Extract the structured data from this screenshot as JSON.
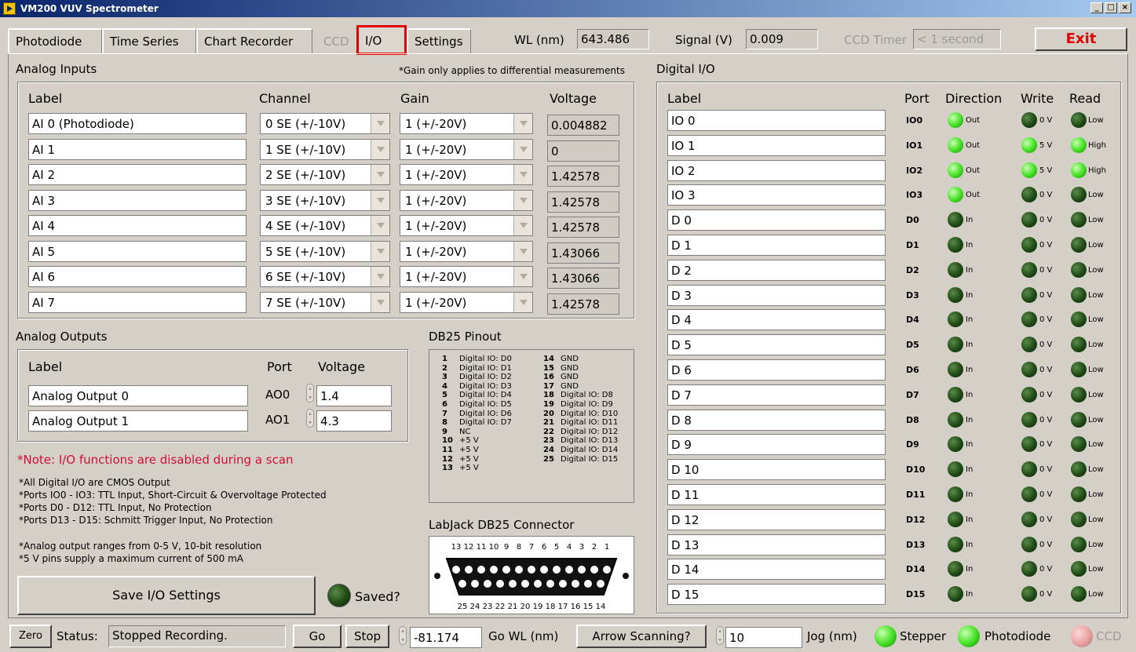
{
  "window": {
    "title": "VM200 VUV Spectrometer",
    "minimize": "_",
    "maximize": "□",
    "close": "×"
  },
  "tabs": [
    "Photodiode",
    "Time Series",
    "Chart Recorder",
    "CCD",
    "I/O",
    "Settings"
  ],
  "header": {
    "wl_label": "WL (nm)",
    "wl_value": "643.486",
    "signal_label": "Signal (V)",
    "signal_value": "0.009",
    "ccd_timer_label": "CCD Timer",
    "ccd_timer_value": "< 1 second",
    "exit_label": "Exit"
  },
  "analog_inputs": {
    "title": "Analog Inputs",
    "gain_note": "*Gain only applies to differential measurements",
    "headers": {
      "label": "Label",
      "channel": "Channel",
      "gain": "Gain",
      "voltage": "Voltage"
    },
    "rows": [
      {
        "label": "AI 0 (Photodiode)",
        "channel": "0 SE (+/-10V)",
        "gain": "1 (+/-20V)",
        "voltage": "0.004882"
      },
      {
        "label": "AI 1",
        "channel": "1 SE (+/-10V)",
        "gain": "1 (+/-20V)",
        "voltage": "0"
      },
      {
        "label": "AI 2",
        "channel": "2 SE (+/-10V)",
        "gain": "1 (+/-20V)",
        "voltage": "1.42578"
      },
      {
        "label": "AI 3",
        "channel": "3 SE (+/-10V)",
        "gain": "1 (+/-20V)",
        "voltage": "1.42578"
      },
      {
        "label": "AI 4",
        "channel": "4 SE (+/-10V)",
        "gain": "1 (+/-20V)",
        "voltage": "1.42578"
      },
      {
        "label": "AI 5",
        "channel": "5 SE (+/-10V)",
        "gain": "1 (+/-20V)",
        "voltage": "1.43066"
      },
      {
        "label": "AI 6",
        "channel": "6 SE (+/-10V)",
        "gain": "1 (+/-20V)",
        "voltage": "1.43066"
      },
      {
        "label": "AI 7",
        "channel": "7 SE (+/-10V)",
        "gain": "1 (+/-20V)",
        "voltage": "1.42578"
      }
    ]
  },
  "analog_outputs": {
    "title": "Analog Outputs",
    "headers": {
      "label": "Label",
      "port": "Port",
      "voltage": "Voltage"
    },
    "rows": [
      {
        "label": "Analog Output 0",
        "port": "AO0",
        "voltage": "1.4"
      },
      {
        "label": "Analog Output 1",
        "port": "AO1",
        "voltage": "4.3"
      }
    ]
  },
  "notes": {
    "warning_prefix": "*Note:",
    "warning_text": " I/O functions are disabled during a scan",
    "lines": [
      "*All Digital I/O are CMOS Output",
      "*Ports IO0 - IO3: TTL Input, Short-Circuit & Overvoltage Protected",
      "*Ports D0 - D12: TTL Input, No Protection",
      "*Ports D13 - D15: Schmitt Trigger Input, No Protection"
    ],
    "lines2": [
      "*Analog output ranges from 0-5 V, 10-bit resolution",
      "*5 V pins supply a maximum current of 500 mA"
    ]
  },
  "save": {
    "button": "Save I/O Settings",
    "saved_label": "Saved?"
  },
  "db25": {
    "title": "DB25 Pinout",
    "left": [
      {
        "n": "1",
        "t": "Digital IO: D0"
      },
      {
        "n": "2",
        "t": "Digital IO: D1"
      },
      {
        "n": "3",
        "t": "Digital IO: D2"
      },
      {
        "n": "4",
        "t": "Digital IO: D3"
      },
      {
        "n": "5",
        "t": "Digital IO: D4"
      },
      {
        "n": "6",
        "t": "Digital IO: D5"
      },
      {
        "n": "7",
        "t": "Digital IO: D6"
      },
      {
        "n": "8",
        "t": "Digital IO: D7"
      },
      {
        "n": "9",
        "t": "NC"
      },
      {
        "n": "10",
        "t": "+5 V"
      },
      {
        "n": "11",
        "t": "+5 V"
      },
      {
        "n": "12",
        "t": "+5 V"
      },
      {
        "n": "13",
        "t": "+5 V"
      }
    ],
    "right": [
      {
        "n": "14",
        "t": "GND"
      },
      {
        "n": "15",
        "t": "GND"
      },
      {
        "n": "16",
        "t": "GND"
      },
      {
        "n": "17",
        "t": "GND"
      },
      {
        "n": "18",
        "t": "Digital IO: D8"
      },
      {
        "n": "19",
        "t": "Digital IO: D9"
      },
      {
        "n": "20",
        "t": "Digital IO: D10"
      },
      {
        "n": "21",
        "t": "Digital IO: D11"
      },
      {
        "n": "22",
        "t": "Digital IO: D12"
      },
      {
        "n": "23",
        "t": "Digital IO: D13"
      },
      {
        "n": "24",
        "t": "Digital IO: D14"
      },
      {
        "n": "25",
        "t": "Digital IO: D15"
      }
    ],
    "connector_title": "LabJack DB25 Connector",
    "top_numbers": [
      "13",
      "12",
      "11",
      "10",
      "9",
      "8",
      "7",
      "6",
      "5",
      "4",
      "3",
      "2",
      "1"
    ],
    "bottom_numbers": [
      "25",
      "24",
      "23",
      "22",
      "21",
      "20",
      "19",
      "18",
      "17",
      "16",
      "15",
      "14"
    ]
  },
  "digital_io": {
    "title": "Digital I/O",
    "headers": {
      "label": "Label",
      "port": "Port",
      "direction": "Direction",
      "write": "Write",
      "read": "Read"
    },
    "rows": [
      {
        "label": "IO 0",
        "port": "IO0",
        "direction": "Out",
        "dir_on": true,
        "write": "0 V",
        "write_on": false,
        "read": "Low",
        "read_on": false
      },
      {
        "label": "IO 1",
        "port": "IO1",
        "direction": "Out",
        "dir_on": true,
        "write": "5 V",
        "write_on": true,
        "read": "High",
        "read_on": true
      },
      {
        "label": "IO 2",
        "port": "IO2",
        "direction": "Out",
        "dir_on": true,
        "write": "5 V",
        "write_on": true,
        "read": "High",
        "read_on": true
      },
      {
        "label": "IO 3",
        "port": "IO3",
        "direction": "Out",
        "dir_on": true,
        "write": "0 V",
        "write_on": false,
        "read": "Low",
        "read_on": false
      },
      {
        "label": "D 0",
        "port": "D0",
        "direction": "In",
        "dir_on": false,
        "write": "0 V",
        "write_on": false,
        "read": "Low",
        "read_on": false
      },
      {
        "label": "D 1",
        "port": "D1",
        "direction": "In",
        "dir_on": false,
        "write": "0 V",
        "write_on": false,
        "read": "Low",
        "read_on": false
      },
      {
        "label": "D 2",
        "port": "D2",
        "direction": "In",
        "dir_on": false,
        "write": "0 V",
        "write_on": false,
        "read": "Low",
        "read_on": false
      },
      {
        "label": "D 3",
        "port": "D3",
        "direction": "In",
        "dir_on": false,
        "write": "0 V",
        "write_on": false,
        "read": "Low",
        "read_on": false
      },
      {
        "label": "D 4",
        "port": "D4",
        "direction": "In",
        "dir_on": false,
        "write": "0 V",
        "write_on": false,
        "read": "Low",
        "read_on": false
      },
      {
        "label": "D 5",
        "port": "D5",
        "direction": "In",
        "dir_on": false,
        "write": "0 V",
        "write_on": false,
        "read": "Low",
        "read_on": false
      },
      {
        "label": "D 6",
        "port": "D6",
        "direction": "In",
        "dir_on": false,
        "write": "0 V",
        "write_on": false,
        "read": "Low",
        "read_on": false
      },
      {
        "label": "D 7",
        "port": "D7",
        "direction": "In",
        "dir_on": false,
        "write": "0 V",
        "write_on": false,
        "read": "Low",
        "read_on": false
      },
      {
        "label": "D 8",
        "port": "D8",
        "direction": "In",
        "dir_on": false,
        "write": "0 V",
        "write_on": false,
        "read": "Low",
        "read_on": false
      },
      {
        "label": "D 9",
        "port": "D9",
        "direction": "In",
        "dir_on": false,
        "write": "0 V",
        "write_on": false,
        "read": "Low",
        "read_on": false
      },
      {
        "label": "D 10",
        "port": "D10",
        "direction": "In",
        "dir_on": false,
        "write": "0 V",
        "write_on": false,
        "read": "Low",
        "read_on": false
      },
      {
        "label": "D 11",
        "port": "D11",
        "direction": "In",
        "dir_on": false,
        "write": "0 V",
        "write_on": false,
        "read": "Low",
        "read_on": false
      },
      {
        "label": "D 12",
        "port": "D12",
        "direction": "In",
        "dir_on": false,
        "write": "0 V",
        "write_on": false,
        "read": "Low",
        "read_on": false
      },
      {
        "label": "D 13",
        "port": "D13",
        "direction": "In",
        "dir_on": false,
        "write": "0 V",
        "write_on": false,
        "read": "Low",
        "read_on": false
      },
      {
        "label": "D 14",
        "port": "D14",
        "direction": "In",
        "dir_on": false,
        "write": "0 V",
        "write_on": false,
        "read": "Low",
        "read_on": false
      },
      {
        "label": "D 15",
        "port": "D15",
        "direction": "In",
        "dir_on": false,
        "write": "0 V",
        "write_on": false,
        "read": "Low",
        "read_on": false
      }
    ]
  },
  "statusbar": {
    "zero": "Zero",
    "status_label": "Status:",
    "status_value": "Stopped Recording.",
    "go": "Go",
    "stop": "Stop",
    "go_wl_value": "-81.174",
    "go_wl_label": "Go WL (nm)",
    "arrow_scanning": "Arrow Scanning?",
    "jog_value": "10",
    "jog_label": "Jog (nm)",
    "stepper": "Stepper",
    "photodiode": "Photodiode",
    "ccd": "CCD"
  },
  "colors": {
    "accent_red": "#e00000",
    "led_on": "#40e020",
    "led_off": "#1f4a14",
    "note_red": "#d01030"
  }
}
